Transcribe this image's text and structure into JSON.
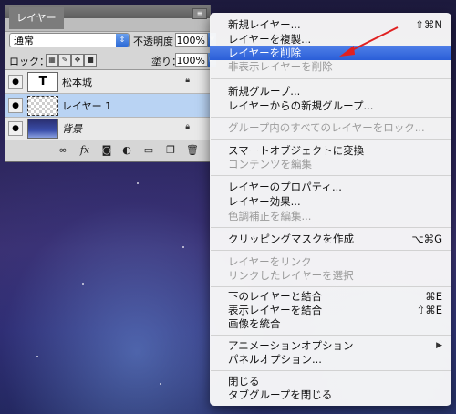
{
  "panel": {
    "tab_label": "レイヤー",
    "blend_mode": "通常",
    "opacity_label": "不透明度：",
    "opacity_value": "100%",
    "lock_label": "ロック：",
    "fill_label": "塗り：",
    "fill_value": "100%",
    "layers": [
      {
        "name": "松本城",
        "thumb": "T",
        "type": "text",
        "locked": true,
        "selected": false
      },
      {
        "name": "レイヤー 1",
        "thumb": "",
        "type": "transparent",
        "locked": false,
        "selected": true
      },
      {
        "name": "背景",
        "thumb": "",
        "type": "image",
        "locked": true,
        "selected": false
      }
    ],
    "footer_icons": [
      "link-icon",
      "fx-icon",
      "mask-icon",
      "adjustment-icon",
      "folder-icon",
      "new-layer-icon",
      "trash-icon"
    ]
  },
  "menu": {
    "items": [
      {
        "label": "新規レイヤー...",
        "shortcut": "⇧⌘N",
        "disabled": false,
        "highlighted": false
      },
      {
        "label": "レイヤーを複製...",
        "shortcut": "",
        "disabled": false,
        "highlighted": false
      },
      {
        "label": "レイヤーを削除",
        "shortcut": "",
        "disabled": false,
        "highlighted": true
      },
      {
        "label": "非表示レイヤーを削除",
        "shortcut": "",
        "disabled": true,
        "highlighted": false
      },
      {
        "label": "新規グループ...",
        "shortcut": "",
        "disabled": false,
        "highlighted": false
      },
      {
        "label": "レイヤーからの新規グループ...",
        "shortcut": "",
        "disabled": false,
        "highlighted": false
      },
      {
        "label": "グループ内のすべてのレイヤーをロック...",
        "shortcut": "",
        "disabled": true,
        "highlighted": false
      },
      {
        "label": "スマートオブジェクトに変換",
        "shortcut": "",
        "disabled": false,
        "highlighted": false
      },
      {
        "label": "コンテンツを編集",
        "shortcut": "",
        "disabled": true,
        "highlighted": false
      },
      {
        "label": "レイヤーのプロパティ...",
        "shortcut": "",
        "disabled": false,
        "highlighted": false
      },
      {
        "label": "レイヤー効果...",
        "shortcut": "",
        "disabled": false,
        "highlighted": false
      },
      {
        "label": "色調補正を編集...",
        "shortcut": "",
        "disabled": true,
        "highlighted": false
      },
      {
        "label": "クリッピングマスクを作成",
        "shortcut": "⌥⌘G",
        "disabled": false,
        "highlighted": false
      },
      {
        "label": "レイヤーをリンク",
        "shortcut": "",
        "disabled": true,
        "highlighted": false
      },
      {
        "label": "リンクしたレイヤーを選択",
        "shortcut": "",
        "disabled": true,
        "highlighted": false
      },
      {
        "label": "下のレイヤーと結合",
        "shortcut": "⌘E",
        "disabled": false,
        "highlighted": false
      },
      {
        "label": "表示レイヤーを結合",
        "shortcut": "⇧⌘E",
        "disabled": false,
        "highlighted": false
      },
      {
        "label": "画像を統合",
        "shortcut": "",
        "disabled": false,
        "highlighted": false
      },
      {
        "label": "アニメーションオプション",
        "shortcut": "▶",
        "disabled": false,
        "highlighted": false
      },
      {
        "label": "パネルオプション...",
        "shortcut": "",
        "disabled": false,
        "highlighted": false
      },
      {
        "label": "閉じる",
        "shortcut": "",
        "disabled": false,
        "highlighted": false
      },
      {
        "label": "タブグループを閉じる",
        "shortcut": "",
        "disabled": false,
        "highlighted": false
      }
    ]
  },
  "colors": {
    "highlight": "#2a5ed8",
    "annotation_arrow": "#e02020",
    "selected_layer": "#b9d3f3"
  }
}
